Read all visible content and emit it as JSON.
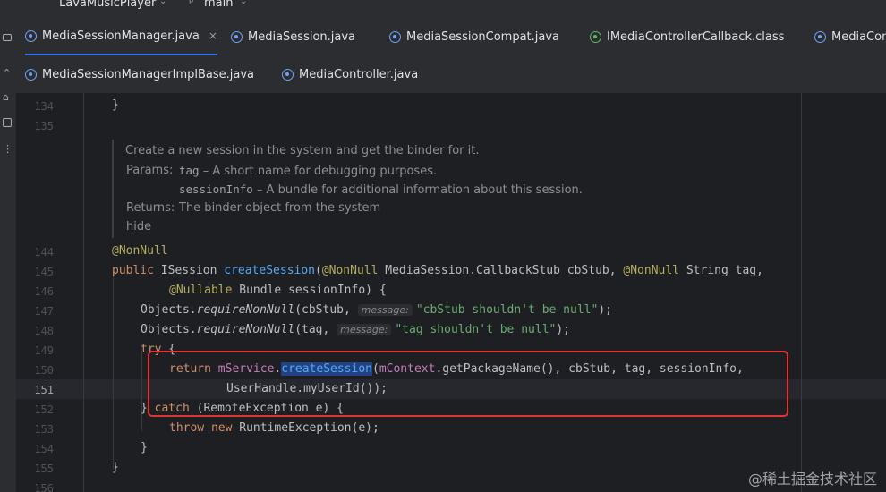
{
  "titlebar": {
    "project": "LavaMusicPlayer",
    "branch_symbol": "ᵖ",
    "branch": "main"
  },
  "tabs_row1": [
    {
      "label": "MediaSessionManager.java",
      "icon": "java-class-icon",
      "active": true,
      "close": "×"
    },
    {
      "label": "MediaSession.java",
      "icon": "java-class-icon"
    },
    {
      "label": "MediaSessionCompat.java",
      "icon": "java-class-icon"
    },
    {
      "label": "IMediaControllerCallback.class",
      "icon": "interface-icon"
    },
    {
      "label": "MediaCon",
      "icon": "java-class-icon"
    }
  ],
  "tabs_row2": [
    {
      "label": "MediaSessionManagerImplBase.java",
      "icon": "java-class-icon"
    },
    {
      "label": "MediaController.java",
      "icon": "java-class-icon"
    }
  ],
  "gutter": {
    "l134": "134",
    "l135": "135",
    "l144": "144",
    "l145": "145",
    "l146": "146",
    "l147": "147",
    "l148": "148",
    "l149": "149",
    "l150": "150",
    "l151": "151",
    "l152": "152",
    "l153": "153",
    "l154": "154",
    "l155": "155",
    "l156": "156"
  },
  "doc": {
    "summary": "Create a new session in the system and get the binder for it.",
    "params_label": "Params:",
    "p1_name": "tag",
    "p1_desc": " – A short name for debugging purposes.",
    "p2_name": "sessionInfo",
    "p2_desc": " – A bundle for additional information about this session.",
    "returns_label": "Returns:",
    "returns_desc": "The binder object from the system",
    "hide": "hide"
  },
  "code": {
    "c134_brace": "}",
    "c144_ann": "@NonNull",
    "c145_public": "public",
    "c145_type": " ISession ",
    "c145_name": "createSession",
    "c145_open": "(",
    "c145_ann1": "@NonNull",
    "c145_mid": " MediaSession.CallbackStub cbStub, ",
    "c145_ann2": "@NonNull",
    "c145_end": " String tag,",
    "c146_ann": "@Nullable",
    "c146_rest": " Bundle sessionInfo) {",
    "c147_a": "Objects.",
    "c147_fn": "requireNonNull",
    "c147_b": "(cbStub, ",
    "c147_hint": "message:",
    "c147_str": "\"cbStub shouldn't be null\"",
    "c147_end": ");",
    "c148_a": "Objects.",
    "c148_fn": "requireNonNull",
    "c148_b": "(tag, ",
    "c148_hint": "message:",
    "c148_str": "\"tag shouldn't be null\"",
    "c148_end": ");",
    "c149_try": "try",
    "c149_brace": " {",
    "c150_return": "return",
    "c150_field": " mService",
    "c150_dot": ".",
    "c150_call": "createSession",
    "c150_open": "(",
    "c150_ctx": "mContext",
    "c150_rest": ".getPackageName(), cbStub, tag, sessionInfo,",
    "c151": "UserHandle.myUserId());",
    "c152_a": "} ",
    "c152_catch": "catch",
    "c152_rest": " (RemoteException e) {",
    "c153_throw": "throw",
    "c153_new": " new",
    "c153_rest": " RuntimeException(e);",
    "c154": "}",
    "c155": "}"
  },
  "watermark": "@稀土掘金技术社区",
  "colors": {
    "background": "#1e1f22",
    "keyword": "#cf8e6d",
    "function": "#56a8f5",
    "string": "#6aab73",
    "annotation": "#b3ae60",
    "field": "#c77dbb",
    "highlight_box": "#e03535"
  }
}
